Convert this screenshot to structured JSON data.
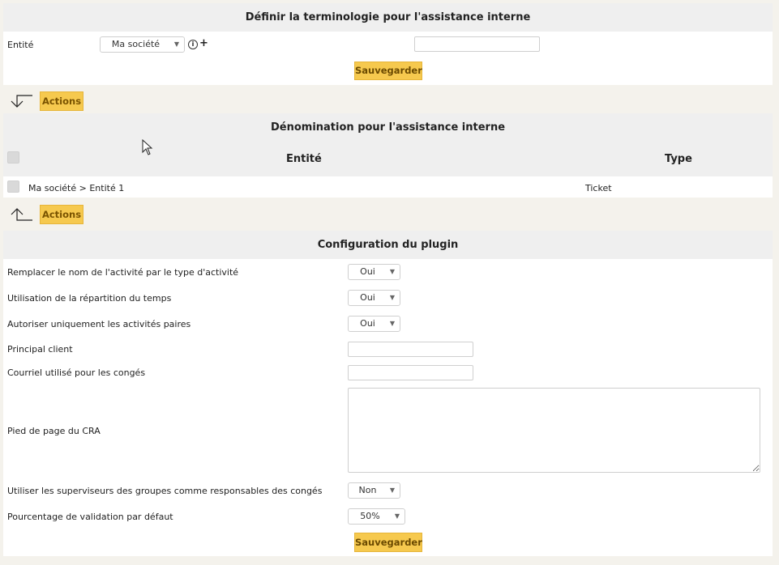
{
  "terminology": {
    "title": "Définir la terminologie pour l'assistance interne",
    "entity_label": "Entité",
    "entity_value": "Ma société",
    "info_icon": "info-circle-icon",
    "plus_icon": "plus-icon",
    "term_value": "",
    "save_label": "Sauvegarder"
  },
  "actions_top": {
    "label": "Actions",
    "arrow_icon": "arrow-down-left-icon"
  },
  "denomination": {
    "title": "Dénomination pour l'assistance interne",
    "columns": [
      "Entité",
      "Type"
    ],
    "rows": [
      {
        "entity": "Ma société > Entité 1",
        "type": "Ticket"
      }
    ]
  },
  "actions_bottom": {
    "label": "Actions",
    "arrow_icon": "arrow-up-left-icon"
  },
  "config": {
    "title": "Configuration du plugin",
    "fields": [
      {
        "label": "Remplacer le nom de l'activité par le type d'activité",
        "value": "Oui"
      },
      {
        "label": "Utilisation de la répartition du temps",
        "value": "Oui"
      },
      {
        "label": "Autoriser uniquement les activités paires",
        "value": "Oui"
      },
      {
        "label": "Principal client",
        "value": ""
      },
      {
        "label": "Courriel utilisé pour les congés",
        "value": ""
      },
      {
        "label": "Pied de page du CRA",
        "value": ""
      },
      {
        "label": "Utiliser les superviseurs des groupes comme responsables des congés",
        "value": "Non"
      },
      {
        "label": "Pourcentage de validation par défaut",
        "value": "50%"
      }
    ],
    "save_label": "Sauvegarder"
  },
  "colors": {
    "accent": "#f6c94e",
    "header_bg": "#efefef",
    "page_bg": "#f4f2ec"
  }
}
